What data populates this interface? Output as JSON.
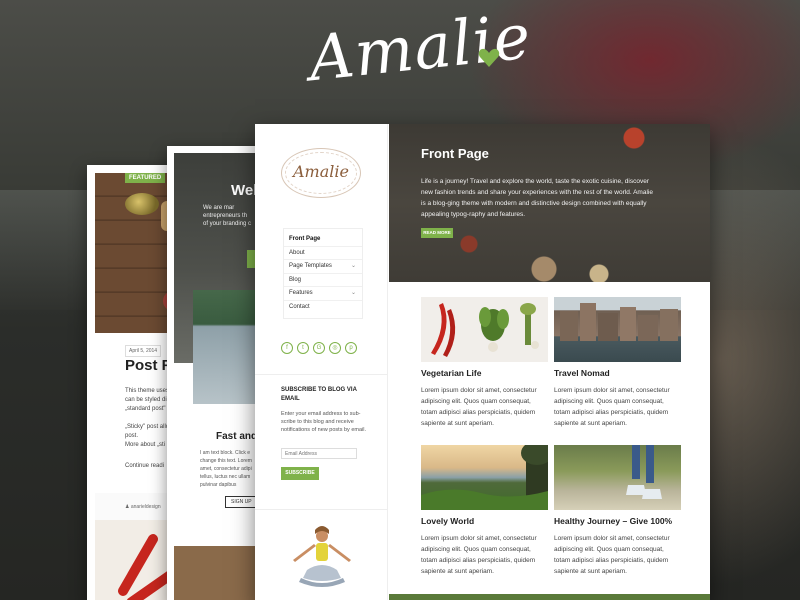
{
  "brand": {
    "name": "Amalie",
    "accent": "#7fb24a"
  },
  "card1": {
    "badge": "FEATURED",
    "date": "April 5, 2014",
    "title": "Post Fo",
    "lines": [
      "This theme uses",
      "can be styled di",
      "„standard post\"",
      "",
      "„Sticky\" post allo",
      "post.",
      "More about „sti"
    ],
    "continue": "Continue readi",
    "author": "♟ anarieldesign"
  },
  "card2": {
    "hero_title": "Wel",
    "hero_lines": [
      "We are mar",
      "entrepreneurs th",
      "of your branding c"
    ],
    "section_title": "Fast and",
    "section_lines": [
      "I am text block. Click e",
      "change this text. Lorem",
      "amet, consectetur adipi",
      "tellus, luctus nec ullam",
      "pulvinar dapibus"
    ],
    "signup": "SIGN UP"
  },
  "sidebar": {
    "logo": "Amalie",
    "menu": [
      {
        "label": "Front Page",
        "caret": ""
      },
      {
        "label": "About",
        "caret": ""
      },
      {
        "label": "Page Templates",
        "caret": "⌄"
      },
      {
        "label": "Blog",
        "caret": ""
      },
      {
        "label": "Features",
        "caret": "⌄"
      },
      {
        "label": "Contact",
        "caret": ""
      }
    ],
    "social_icons": [
      "facebook-icon",
      "twitter-icon",
      "google-plus-icon",
      "instagram-icon",
      "pinterest-icon"
    ],
    "social_glyphs": [
      "f",
      "t",
      "G",
      "◎",
      "p"
    ],
    "subscribe_title": "SUBSCRIBE TO BLOG VIA EMAIL",
    "subscribe_text": "Enter your email address to sub-scribe to this blog and receive notifications of new posts by email.",
    "email_placeholder": "Email Address",
    "subscribe_button": "SUBSCRIBE"
  },
  "hero": {
    "title": "Front Page",
    "text": "Life is a journey! Travel and explore the world, taste the exotic cuisine, discover new fashion trends and share your experiences with the rest of the world. Amalie is a blog-ging theme with modern and distinctive design combined with equally appealing typog-raphy and features.",
    "button": "READ MORE"
  },
  "posts": [
    {
      "title": "Vegetarian Life",
      "text": "Lorem ipsum dolor sit amet, consectetur adipiscing elit. Quos quam consequat, totam adipisci alias perspiciatis, quidem sapiente at sunt aperiam."
    },
    {
      "title": "Travel Nomad",
      "text": "Lorem ipsum dolor sit amet, consectetur adipiscing elit. Quos quam consequat, totam adipisci alias perspiciatis, quidem sapiente at sunt aperiam."
    },
    {
      "title": "Lovely World",
      "text": "Lorem ipsum dolor sit amet, consectetur adipiscing elit. Quos quam consequat, totam adipisci alias perspiciatis, quidem sapiente at sunt aperiam."
    },
    {
      "title": "Healthy Journey – Give 100%",
      "text": "Lorem ipsum dolor sit amet, consectetur adipiscing elit. Quos quam consequat, totam adipisci alias perspiciatis, quidem sapiente at sunt aperiam."
    }
  ]
}
